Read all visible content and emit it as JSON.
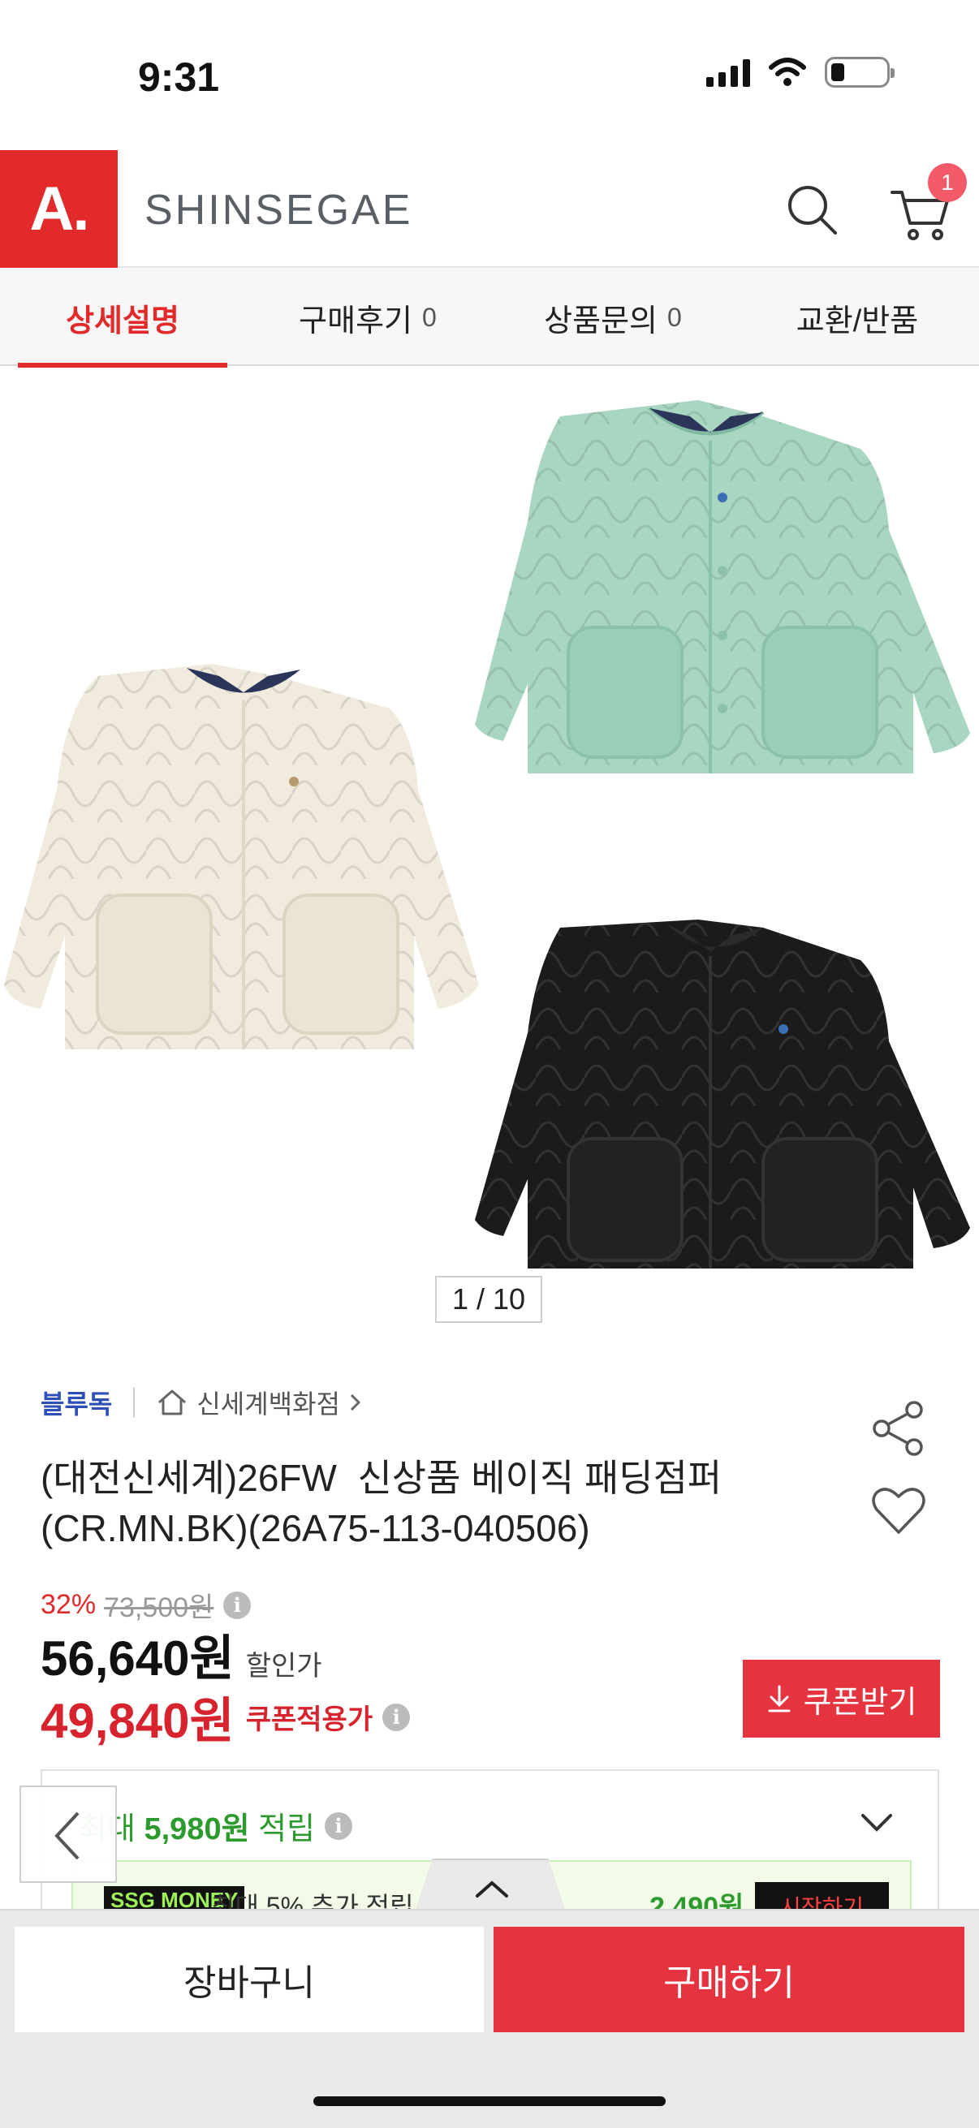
{
  "status_bar": {
    "time": "9:31"
  },
  "header": {
    "logo_text": "A.",
    "brand_text": "SHINSEGAE",
    "cart_count": "1",
    "accent_color": "#e22a2a"
  },
  "tabs": [
    {
      "label": "상세설명",
      "count": "",
      "active": true
    },
    {
      "label": "구매후기",
      "count": "0",
      "active": false
    },
    {
      "label": "상품문의",
      "count": "0",
      "active": false
    },
    {
      "label": "교환/반품",
      "count": "",
      "active": false
    }
  ],
  "gallery": {
    "page_indicator": "1 / 10",
    "items": [
      {
        "name": "mint-jacket",
        "color": "#a8d6c1"
      },
      {
        "name": "cream-jacket",
        "color": "#f1ebde"
      },
      {
        "name": "black-jacket",
        "color": "#1b1b1b"
      }
    ]
  },
  "product": {
    "brand": "블루독",
    "store": "신세계백화점",
    "title_line1": "(대전신세계)26FW  신상품 베이직 패딩점퍼",
    "title_line2": "(CR.MN.BK)(26A75-113-040506)",
    "discount_pct": "32%",
    "original_price": "73,500원",
    "sale_price": "56,640원",
    "sale_label": "할인가",
    "coupon_price": "49,840원",
    "coupon_label": "쿠폰적용가",
    "coupon_button": "쿠폰받기"
  },
  "points": {
    "prefix": "최대",
    "amount": "5,980원",
    "suffix": "적립",
    "promo_badge": "SSG MONEY",
    "promo_text": "최대 5% 추가 적립",
    "promo_amount": "2,490원",
    "promo_button": "시작하기"
  },
  "bottom_bar": {
    "cart_label": "장바구니",
    "buy_label": "구매하기"
  }
}
